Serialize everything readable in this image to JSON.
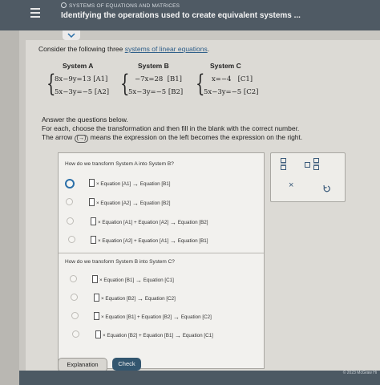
{
  "header": {
    "topic": "SYSTEMS OF EQUATIONS AND MATRICES",
    "title": "Identifying the operations used to create equivalent systems ..."
  },
  "intro": {
    "prefix": "Consider the following three ",
    "link": "systems of linear equations",
    "suffix": "."
  },
  "systems": [
    {
      "label": "System A",
      "eq1": "8x−9y=13",
      "tag1": "[A1]",
      "eq2": "5x−3y=−5",
      "tag2": "[A2]"
    },
    {
      "label": "System B",
      "eq1": "−7x=28",
      "tag1": "[B1]",
      "eq2": "5x−3y=−5",
      "tag2": "[B2]"
    },
    {
      "label": "System C",
      "eq1": "x=−4",
      "tag1": "[C1]",
      "eq2": "5x−3y=−5",
      "tag2": "[C2]"
    }
  ],
  "instructions": {
    "line1": "Answer the questions below.",
    "line2": "For each, choose the transformation and then fill in the blank with the correct number.",
    "line3a": "The arrow ",
    "arrow_symbol": "(→)",
    "line3b": " means the expression on the left becomes the expression on the right."
  },
  "question1": {
    "prompt": "How do we transform System A into System B?",
    "options": [
      {
        "pre": "× Equation [A1] ",
        "arrow": "→",
        "post": " Equation [B1]"
      },
      {
        "pre": "× Equation [A2] ",
        "arrow": "→",
        "post": " Equation [B2]"
      },
      {
        "pre": "× Equation [A1] + Equation [A2] ",
        "arrow": "→",
        "post": " Equation [B2]"
      },
      {
        "pre": "× Equation [A2] + Equation [A1] ",
        "arrow": "→",
        "post": " Equation [B1]"
      }
    ]
  },
  "question2": {
    "prompt": "How do we transform System B into System C?",
    "options": [
      {
        "pre": "× Equation [B1] ",
        "arrow": "→",
        "post": " Equation [C1]"
      },
      {
        "pre": "× Equation [B2] ",
        "arrow": "→",
        "post": " Equation [C2]"
      },
      {
        "pre": "× Equation [B1] + Equation [B2] ",
        "arrow": "→",
        "post": " Equation [C2]"
      },
      {
        "pre": "× Equation [B2] + Equation [B1] ",
        "arrow": "→",
        "post": " Equation [C1]"
      }
    ]
  },
  "toolbar": {
    "clear": "×",
    "icons": [
      "fraction-icon",
      "mixed-number-icon",
      "undo-icon"
    ]
  },
  "buttons": {
    "explanation": "Explanation",
    "check": "Check"
  },
  "footer": {
    "copyright": "© 2023 McGraw Hi"
  },
  "colors": {
    "header": "#4f5a64",
    "check_button": "#33566f",
    "selected_radio": "#2b6fa8",
    "link": "#2f5f8a"
  }
}
